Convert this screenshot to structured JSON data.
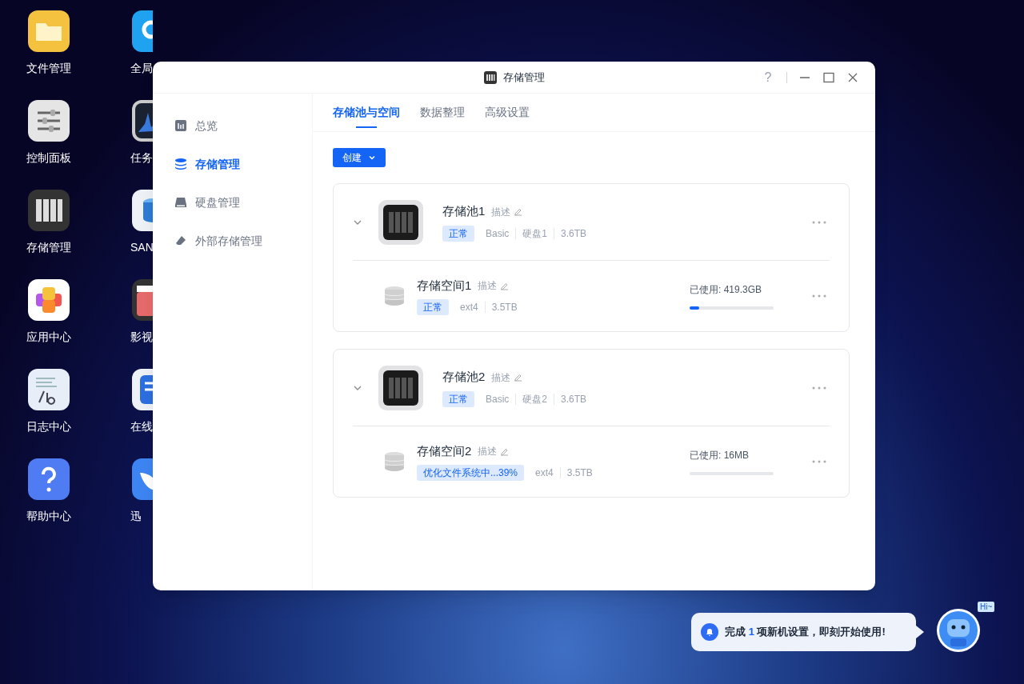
{
  "desktop_icons": [
    {
      "label": "文件管理"
    },
    {
      "label": "控制面板"
    },
    {
      "label": "存储管理"
    },
    {
      "label": "应用中心"
    },
    {
      "label": "日志中心"
    },
    {
      "label": "帮助中心"
    }
  ],
  "desktop_icons_column_2": [
    {
      "label": "全局"
    },
    {
      "label": "任务"
    },
    {
      "label": "SAN"
    },
    {
      "label": "影视"
    },
    {
      "label": "在线"
    },
    {
      "label": "迅"
    }
  ],
  "window": {
    "title": "存储管理",
    "help": "?",
    "sidebar": {
      "items": [
        {
          "label": "总览",
          "selected": false
        },
        {
          "label": "存储管理",
          "selected": true
        },
        {
          "label": "硬盘管理",
          "selected": false
        },
        {
          "label": "外部存储管理",
          "selected": false
        }
      ]
    },
    "tabs": [
      {
        "label": "存储池与空间",
        "selected": true
      },
      {
        "label": "数据整理",
        "selected": false
      },
      {
        "label": "高级设置",
        "selected": false
      }
    ],
    "create_button": "创建",
    "pools": [
      {
        "name": "存储池1",
        "description": "描述",
        "status": "正常",
        "type": "Basic",
        "disk": "硬盘1",
        "capacity": "3.6TB",
        "expanded": true,
        "volumes": [
          {
            "name": "存储空间1",
            "description": "描述",
            "status": "正常",
            "filesystem": "ext4",
            "capacity": "3.5TB",
            "used": "已使用: 419.3GB",
            "level": 0.11
          }
        ]
      },
      {
        "name": "存储池2",
        "description": "描述",
        "status": "正常",
        "type": "Basic",
        "disk": "硬盘2",
        "capacity": "3.6TB",
        "expanded": true,
        "volumes": [
          {
            "name": "存储空间2",
            "description": "描述",
            "status": "优化文件系统中...39%",
            "filesystem": "ext4",
            "capacity": "3.5TB",
            "used": "已使用: 16MB",
            "level": 0
          }
        ]
      }
    ]
  },
  "notification": {
    "prefix": "完成",
    "count": "1",
    "suffix": "项新机设置，即刻开始使用!"
  },
  "assistant": {
    "greeting": "Hi~"
  }
}
